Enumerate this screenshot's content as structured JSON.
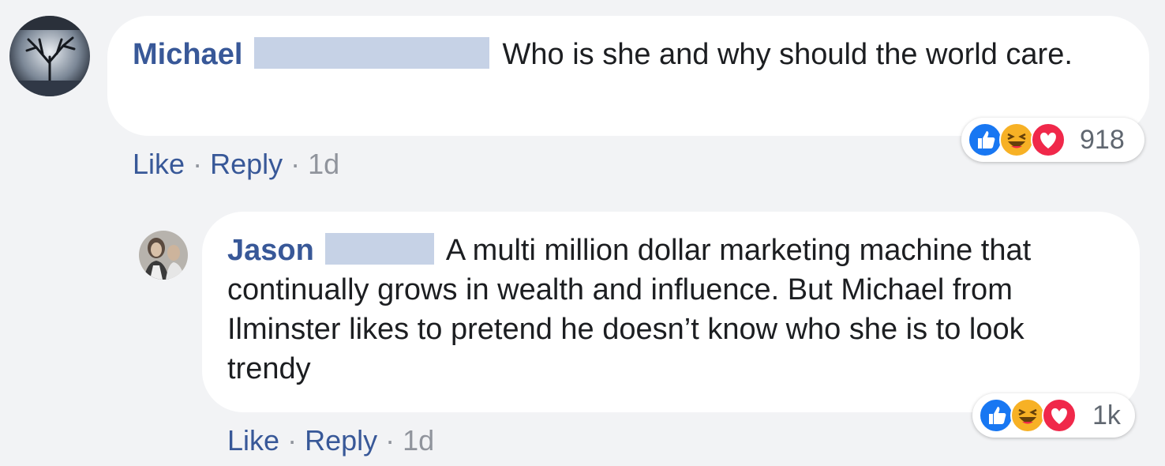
{
  "comments": [
    {
      "author": "Michael",
      "text": "Who is she and why should the world care.",
      "actions": {
        "like": "Like",
        "reply": "Reply",
        "time": "1d",
        "sep": "·"
      },
      "reactions": {
        "count": "918",
        "types": [
          "like-icon",
          "haha-icon",
          "love-icon"
        ]
      }
    },
    {
      "author": "Jason",
      "text": "A multi million dollar marketing machine that continually grows in wealth and influence. But Michael from Ilminster likes to pretend he doesn’t know who she is to look trendy",
      "actions": {
        "like": "Like",
        "reply": "Reply",
        "time": "1d",
        "sep": "·"
      },
      "reactions": {
        "count": "1k",
        "types": [
          "like-icon",
          "haha-icon",
          "love-icon"
        ]
      }
    }
  ],
  "colors": {
    "background": "#f2f3f5",
    "bubble": "#ffffff",
    "author": "#385898",
    "meta": "#90949c",
    "redaction": "#c6d2e6",
    "like": "#1877f2",
    "haha": "#f7b125",
    "love": "#f0284a"
  }
}
